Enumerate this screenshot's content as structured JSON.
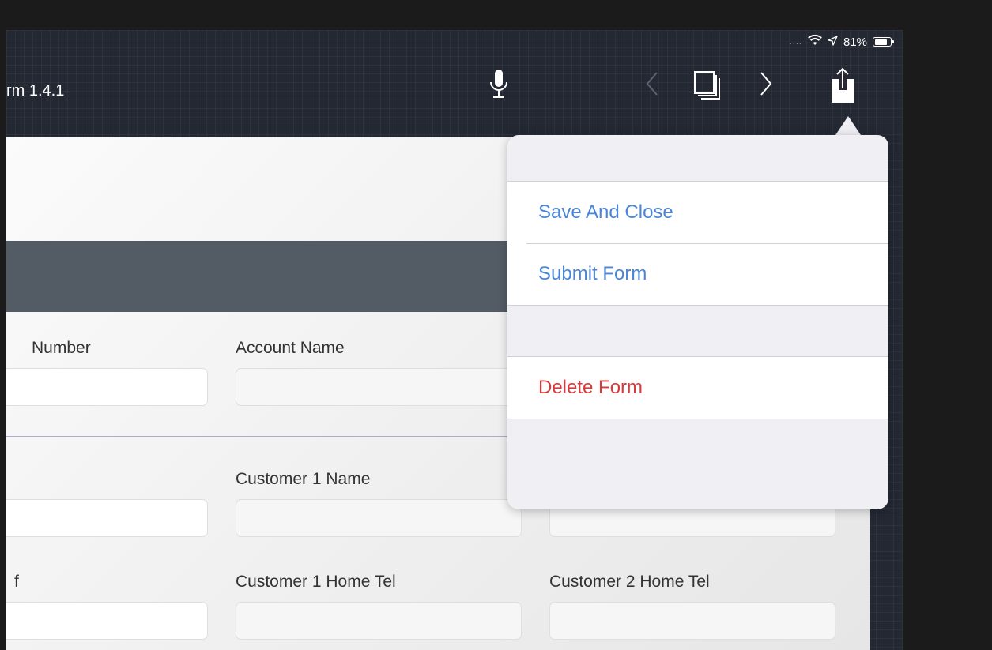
{
  "statusbar": {
    "signal": "....",
    "battery_percent": "81%",
    "battery_level": 0.81
  },
  "navbar": {
    "title": "rm 1.4.1"
  },
  "form": {
    "row1": {
      "label_a": "Number",
      "label_b": "Account Name"
    },
    "row2": {
      "label_b": "Customer 1 Name"
    },
    "row3": {
      "label_a": "f",
      "label_b": "Customer 1 Home Tel",
      "label_c": "Customer 2 Home Tel"
    }
  },
  "menu": {
    "save_and_close": "Save And Close",
    "submit_form": "Submit Form",
    "delete_form": "Delete Form"
  },
  "colors": {
    "accent_blue": "#4a86d8",
    "destructive_red": "#d9393b",
    "section_bar": "#535b65"
  }
}
